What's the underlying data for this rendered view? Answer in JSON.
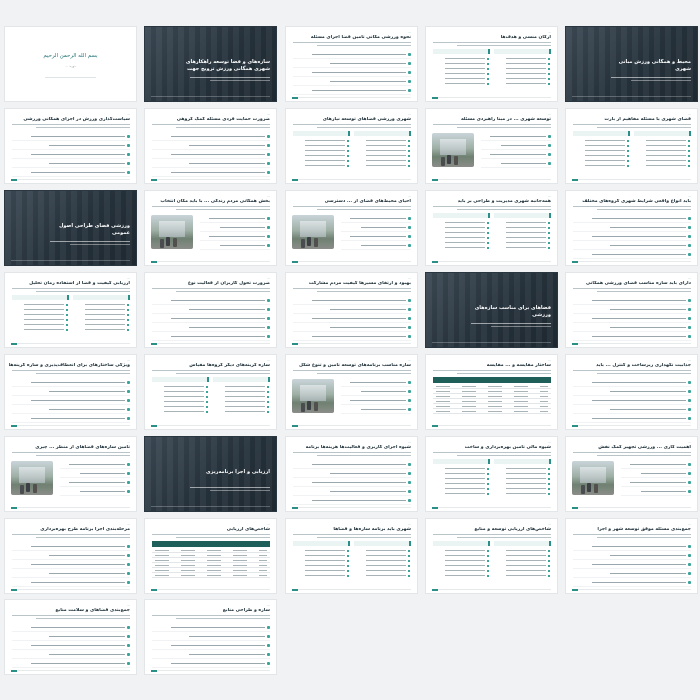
{
  "document": {
    "cover": {
      "title": "بسم الله الرحمن الرحیم",
      "subtitle": "دوره: ..."
    },
    "slides": [
      {
        "kind": "cover"
      },
      {
        "kind": "dark",
        "title": "سازه‌های و فضا توسعه راهکارهای شهری همگانی ورزش ترویج جهت",
        "kicker": ""
      },
      {
        "kind": "bullets",
        "title": "نحوه ورزشی مکانی تأمین فضا اجرای مسئله",
        "kicker": "..."
      },
      {
        "kind": "twocol",
        "title": "ارکان منسی و هدف‌ها",
        "kicker": "..."
      },
      {
        "kind": "dark",
        "title": "محیط و همگانی ورزش مبانی شهری",
        "kicker": ""
      },
      {
        "kind": "bullets",
        "title": "سیاست‌گذاری ورزش در اجرای همگانی ورزشی",
        "kicker": "..."
      },
      {
        "kind": "bullets",
        "title": "ضرورت حمایت فردی مسئله کمک گروهی",
        "kicker": "..."
      },
      {
        "kind": "twocol",
        "title": "شهری ورزشی فضاهای توسعه نیازهای",
        "kicker": "..."
      },
      {
        "kind": "photo",
        "title": "توسعه شهری ... در مبنا راهبردی مسئله",
        "kicker": "..."
      },
      {
        "kind": "twocol",
        "title": "فضای شهری با مسئله مفاهیم از بارت",
        "kicker": "..."
      },
      {
        "kind": "dark",
        "title": "ورزشی فضای طراحی اصول عمومی",
        "kicker": ""
      },
      {
        "kind": "photo",
        "title": "بخش همگانی مردم زندگی ... با باید مکان انتخاب",
        "kicker": "..."
      },
      {
        "kind": "photo",
        "title": "احیای محیط‌های فضای از ... دسترسی",
        "kicker": "..."
      },
      {
        "kind": "twocol",
        "title": "همه‌جانبه شهری مدیریت و طراحی بر باید",
        "kicker": "..."
      },
      {
        "kind": "bullets",
        "title": "باید انواع واقعی شرایط شهری گروه‌های مختلف",
        "kicker": "..."
      },
      {
        "kind": "twocol",
        "title": "ارزیابی کیفیت و فضا از استفاده زمان تحلیل",
        "kicker": "..."
      },
      {
        "kind": "bullets",
        "title": "ضرورت تحول کاربران از فعالیت نوع",
        "kicker": "..."
      },
      {
        "kind": "bullets",
        "title": "بهبود و ارتقای مسیرها کیفیت مردم مشارکت",
        "kicker": "..."
      },
      {
        "kind": "dark",
        "title": "فضاهای برای مناسب سازه‌های ورزشی",
        "kicker": ""
      },
      {
        "kind": "bullets",
        "title": "دارای باید سازه مناسب فضای ورزشی همگانی",
        "kicker": "..."
      },
      {
        "kind": "bullets",
        "title": "ویژگی ساختارهای برای انعطاف‌پذیری و سازه گزینه‌های",
        "kicker": "..."
      },
      {
        "kind": "twocol",
        "title": "سازه گزینه‌های دیگر گروه‌ها مقیاس",
        "kicker": "..."
      },
      {
        "kind": "photo",
        "title": "سازه مناسب برنامه‌های توسعه تأمین و تنوع شکل",
        "kicker": "..."
      },
      {
        "kind": "table",
        "title": "ساختار مقایسه و ... مقایسه",
        "kicker": "..."
      },
      {
        "kind": "bullets",
        "title": "جذابیت نگهداری زیرساخت و کنترل ... باید",
        "kicker": "..."
      },
      {
        "kind": "photo",
        "title": "تأمین سازه‌های فضاهای از منظر ... چیزی",
        "kicker": "..."
      },
      {
        "kind": "dark",
        "title": "ارزیابی و اجرا برنامه‌ریزی",
        "kicker": ""
      },
      {
        "kind": "bullets",
        "title": "شیوه اجرای کاربری و فعالیت‌ها هزینه‌ها برنامه",
        "kicker": "..."
      },
      {
        "kind": "twocol",
        "title": "شیوه مالی تأمین بهره‌برداری و ساخت",
        "kicker": "..."
      },
      {
        "kind": "photo",
        "title": "اهمیت کاری ... ورزشی تجهیز کمک نقش",
        "kicker": "..."
      },
      {
        "kind": "bullets",
        "title": "مرحله‌بندی اجرا برنامه طرح بهره‌برداری",
        "kicker": "..."
      },
      {
        "kind": "table",
        "title": "شاخص‌های ارزیابی",
        "kicker": "..."
      },
      {
        "kind": "twocol",
        "title": "شهری باید برنامه سازه‌ها و فضاها",
        "kicker": "..."
      },
      {
        "kind": "twocol",
        "title": "شاخص‌های ارزیابی توسعه و منابع",
        "kicker": "..."
      },
      {
        "kind": "bullets",
        "title": "جمع‌بندی مسئله موفق توسعه شهر و اجرا",
        "kicker": "..."
      },
      {
        "kind": "bullets",
        "title": "جمع‌بندی فضاهای و سلامت منابع",
        "kicker": "..."
      },
      {
        "kind": "bullets",
        "title": "سازه و طراحی منابع",
        "kicker": "..."
      }
    ]
  }
}
